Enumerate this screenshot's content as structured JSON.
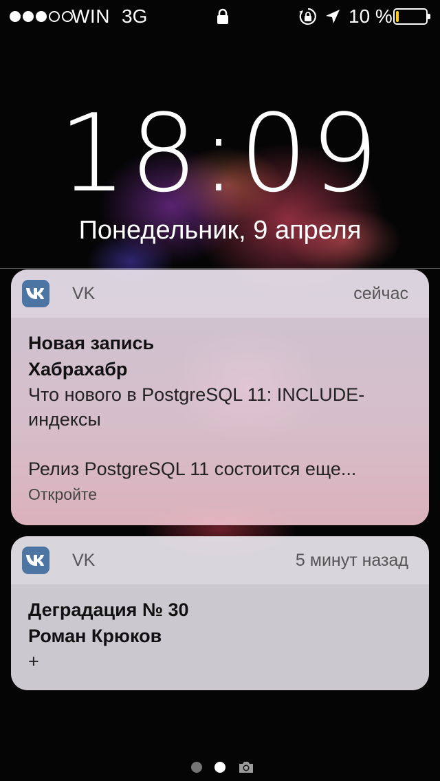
{
  "status": {
    "carrier": "WIN",
    "network": "3G",
    "battery_text": "10 %",
    "battery_level": 0.1,
    "signal_bars_filled": 3,
    "signal_bars_total": 5
  },
  "lock_screen": {
    "time": "18:09",
    "date": "Понедельник, 9 апреля"
  },
  "notifications": [
    {
      "app": "VK",
      "time": "сейчас",
      "title": "Новая запись",
      "subtitle": "Хабрахабр",
      "body_line1": "Что нового в PostgreSQL 11: INCLUDE-",
      "body_line2": "индексы",
      "body_line3": "Релиз PostgreSQL 11 состоится еще...",
      "action": "Откройте"
    },
    {
      "app": "VK",
      "time": "5 минут назад",
      "title": "Деградация № 30",
      "subtitle": "Роман Крюков",
      "body_line1": "+"
    }
  ],
  "colors": {
    "vk_brand": "#4c75a3",
    "battery_low": "#f7ce1a"
  },
  "icons": [
    "lock-icon",
    "orientation-lock-icon",
    "location-icon",
    "battery-icon",
    "vk-icon",
    "camera-icon"
  ]
}
